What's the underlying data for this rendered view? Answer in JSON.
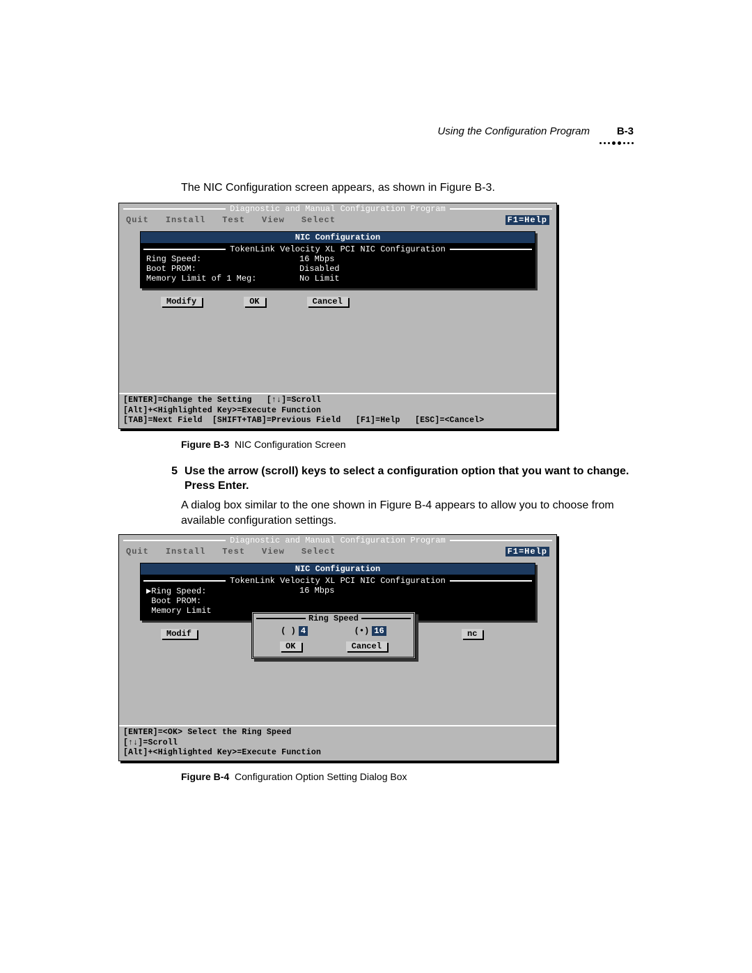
{
  "header": {
    "running_title": "Using the Configuration Program",
    "page_number": "B-3"
  },
  "intro_text": "The NIC Configuration screen appears, as shown in Figure B-3.",
  "fig1": {
    "program_title": "Diagnostic and Manual Configuration Program",
    "menu": {
      "quit": "Quit",
      "install": "Install",
      "tests": "Test",
      "view": "View",
      "select": "Select",
      "help": "F1=Help"
    },
    "panel_title": "NIC Configuration",
    "panel_sub": "TokenLink Velocity XL PCI NIC Configuration",
    "fields": [
      {
        "label": "Ring Speed:",
        "value": "16 Mbps"
      },
      {
        "label": "Boot PROM:",
        "value": "Disabled"
      },
      {
        "label": "Memory Limit of 1 Meg:",
        "value": "No Limit"
      }
    ],
    "buttons": {
      "modify": "Modify",
      "ok": "OK",
      "cancel": "Cancel"
    },
    "status": [
      "[ENTER]=Change the Setting   [↑↓]=Scroll",
      "[Alt]+<Highlighted Key>=Execute Function",
      "[TAB]=Next Field  [SHIFT+TAB]=Previous Field   [F1]=Help   [ESC]=<Cancel>"
    ],
    "caption_label": "Figure B-3",
    "caption_text": "NIC Configuration Screen"
  },
  "step5": {
    "num": "5",
    "text": "Use the arrow (scroll) keys to select a configuration option that you want to change. Press Enter."
  },
  "para2": "A dialog box similar to the one shown in Figure B-4 appears to allow you to choose from available configuration settings.",
  "fig2": {
    "program_title": "Diagnostic and Manual Configuration Program",
    "menu": {
      "quit": "Quit",
      "install": "Install",
      "tests": "Test",
      "view": "View",
      "select": "Select",
      "help": "F1=Help"
    },
    "panel_title": "NIC Configuration",
    "panel_sub": "TokenLink Velocity XL PCI NIC Configuration",
    "fields": [
      {
        "label": "▶Ring Speed:",
        "value": "16 Mbps"
      },
      {
        "label": " Boot PROM:",
        "value": ""
      },
      {
        "label": " Memory Limit",
        "value": ""
      }
    ],
    "buttons": {
      "modify": "Modif",
      "ncel": "nc"
    },
    "popup": {
      "title": "Ring Speed",
      "opt1": "4",
      "opt2": "16",
      "ok": "OK",
      "cancel": "Cancel"
    },
    "status": [
      "[ENTER]=<OK> Select the Ring Speed",
      "[↑↓]=Scroll",
      "[Alt]+<Highlighted Key>=Execute Function"
    ],
    "caption_label": "Figure B-4",
    "caption_text": "Configuration Option Setting Dialog Box"
  }
}
